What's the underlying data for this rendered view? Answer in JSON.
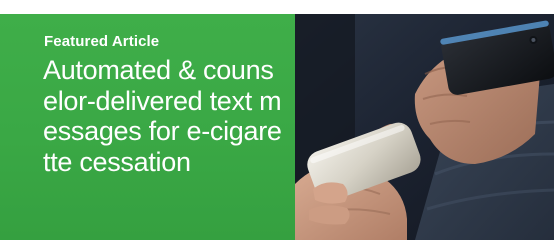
{
  "featured": {
    "eyebrow": "Featured Article",
    "headline": "Automated & counselor-delivered text messages for e-cigarette cessation"
  },
  "image": {
    "icon": "hands-holding-smartphones-photo"
  },
  "colors": {
    "panel_green": "#3aa845",
    "text": "#ffffff",
    "photo_dark": "#1d2430"
  }
}
